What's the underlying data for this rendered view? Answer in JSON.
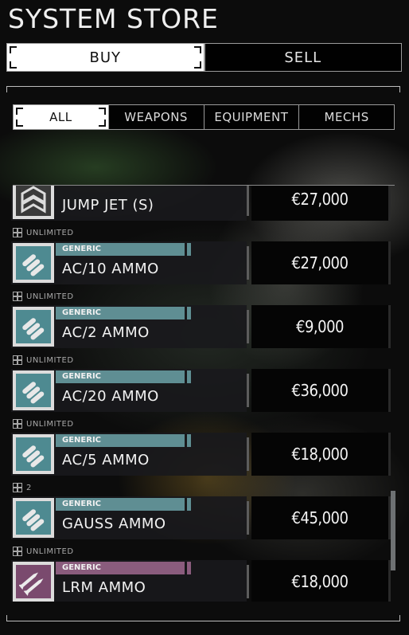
{
  "window": {
    "title": "SYSTEM STORE"
  },
  "mode_tabs": [
    {
      "label": "BUY",
      "active": true
    },
    {
      "label": "SELL",
      "active": false
    }
  ],
  "filter_tabs": [
    {
      "label": "ALL",
      "active": true
    },
    {
      "label": "WEAPONS",
      "active": false
    },
    {
      "label": "EQUIPMENT",
      "active": false
    },
    {
      "label": "MECHS",
      "active": false
    }
  ],
  "colors": {
    "generic_tag": "#5f8e93",
    "lrm_tag": "#8a5c7d",
    "icon_teal": "#4e8a91",
    "icon_purple": "#7a4a6e"
  },
  "items": [
    {
      "availability": "",
      "tag": "",
      "name": "JUMP JET (S)",
      "price": "€27,000",
      "icon": "jump-jet-icon"
    },
    {
      "availability": "UNLIMITED",
      "tag": "GENERIC",
      "name": "AC/10 AMMO",
      "price": "€27,000",
      "icon": "ballistic-ammo-icon"
    },
    {
      "availability": "UNLIMITED",
      "tag": "GENERIC",
      "name": "AC/2 AMMO",
      "price": "€9,000",
      "icon": "ballistic-ammo-icon"
    },
    {
      "availability": "UNLIMITED",
      "tag": "GENERIC",
      "name": "AC/20 AMMO",
      "price": "€36,000",
      "icon": "ballistic-ammo-icon"
    },
    {
      "availability": "UNLIMITED",
      "tag": "GENERIC",
      "name": "AC/5 AMMO",
      "price": "€18,000",
      "icon": "ballistic-ammo-icon"
    },
    {
      "availability": "2",
      "tag": "GENERIC",
      "name": "GAUSS AMMO",
      "price": "€45,000",
      "icon": "ballistic-ammo-icon"
    },
    {
      "availability": "UNLIMITED",
      "tag": "GENERIC",
      "name": "LRM AMMO",
      "price": "€18,000",
      "icon": "missile-ammo-icon"
    }
  ]
}
